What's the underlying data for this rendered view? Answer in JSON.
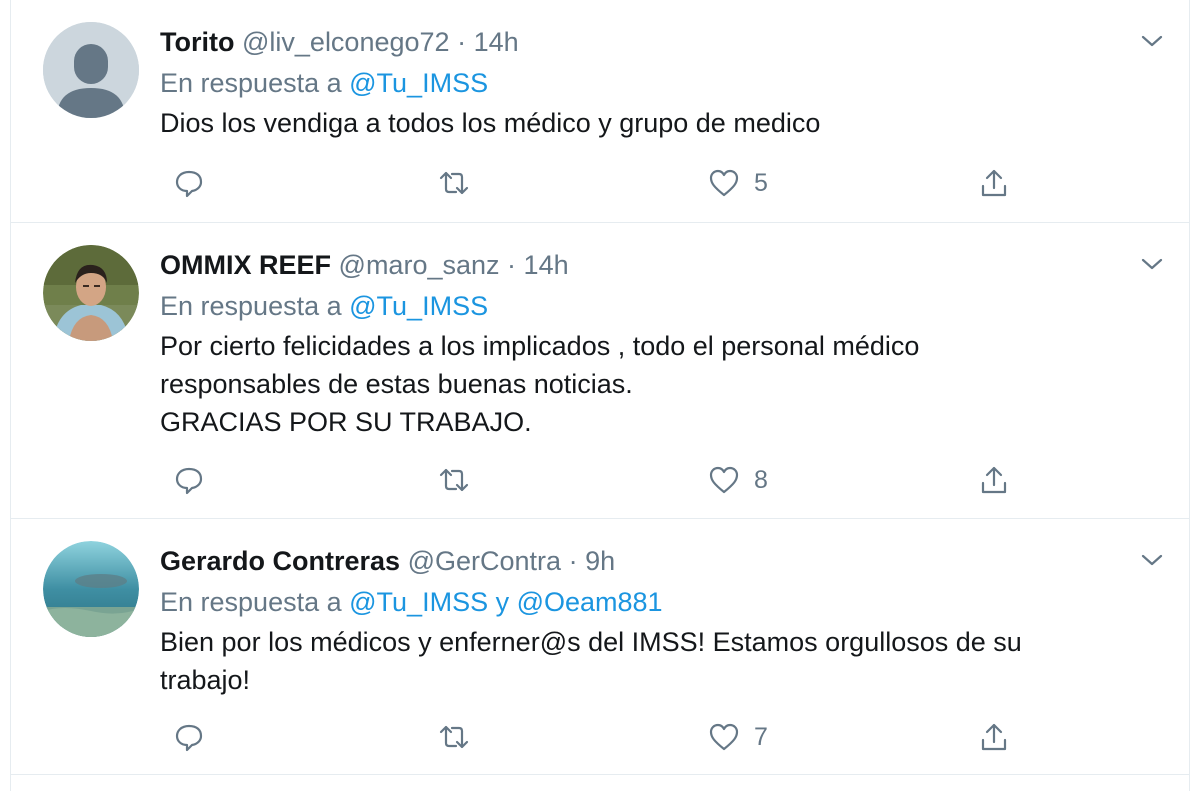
{
  "colors": {
    "accent": "#1b95e0",
    "secondary_text": "#657786",
    "primary_text": "#14171a",
    "divider": "#e6ecf0"
  },
  "tweets": [
    {
      "name": "Torito",
      "handle": "@liv_elconego72",
      "time": "14h",
      "reply_prefix": "En respuesta a",
      "reply_targets": "@Tu_IMSS",
      "text_lines": [
        "Dios los vendiga a todos los médico y grupo de medico"
      ],
      "likes": "5",
      "avatar": "default-avatar-icon"
    },
    {
      "name": "OMMIX REEF",
      "handle": "@maro_sanz",
      "time": "14h",
      "reply_prefix": "En respuesta a",
      "reply_targets": "@Tu_IMSS",
      "text_lines": [
        "Por cierto felicidades a los implicados , todo el personal médico",
        "responsables de estas buenas noticias.",
        "GRACIAS POR SU TRABAJO."
      ],
      "likes": "8",
      "avatar": "user-photo"
    },
    {
      "name": "Gerardo Contreras",
      "handle": "@GerContra",
      "time": "9h",
      "reply_prefix": "En respuesta a",
      "reply_targets": "@Tu_IMSS y @Oeam881",
      "text_lines": [
        "Bien por los médicos y enferner@s del IMSS! Estamos orgullosos de su",
        "trabajo!"
      ],
      "likes": "7",
      "avatar": "underwater-photo"
    }
  ]
}
